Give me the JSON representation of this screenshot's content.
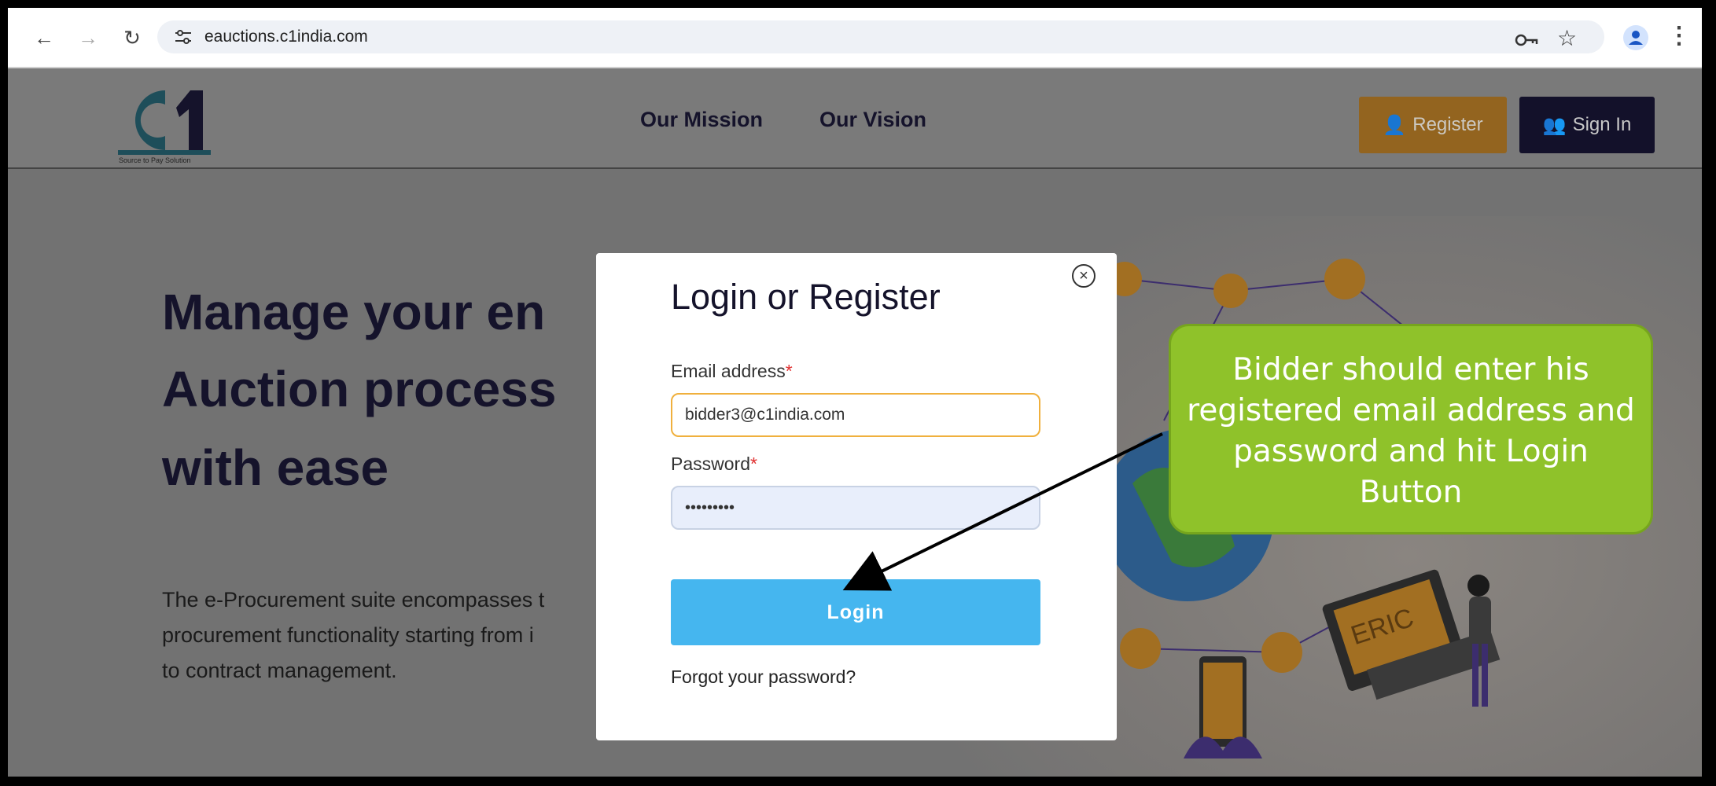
{
  "browser": {
    "url": "eauctions.c1india.com",
    "nav_icons": [
      "back-arrow-icon",
      "forward-arrow-icon",
      "reload-icon"
    ],
    "right_icons": [
      "key-icon",
      "star-icon",
      "profile-icon",
      "menu-icon"
    ]
  },
  "site": {
    "logo_text": "C1",
    "logo_tagline": "Source to Pay Solution",
    "nav": [
      "Our Mission",
      "Our Vision"
    ],
    "register_label": "Register",
    "signin_label": "Sign In",
    "brand_colors": {
      "navy": "#15132b",
      "orange": "#f0a53a",
      "blue": "#45b6ef"
    }
  },
  "hero": {
    "headline": [
      "Manage your en",
      "Auction process",
      "with ease"
    ],
    "paragraph": [
      "The e-Procurement suite encompasses t",
      "procurement functionality starting from i",
      "to contract management."
    ],
    "illustration_label": "ERIC"
  },
  "modal": {
    "title": "Login or Register",
    "email_label": "Email address",
    "email_value": "bidder3@c1india.com",
    "password_label": "Password",
    "password_value": "•••••••••",
    "required_mark": "*",
    "login_label": "Login",
    "forgot_label": "Forgot your password?"
  },
  "callout": {
    "text": "Bidder should enter his registered email address and password and hit Login Button",
    "color": "#8fc22a"
  }
}
